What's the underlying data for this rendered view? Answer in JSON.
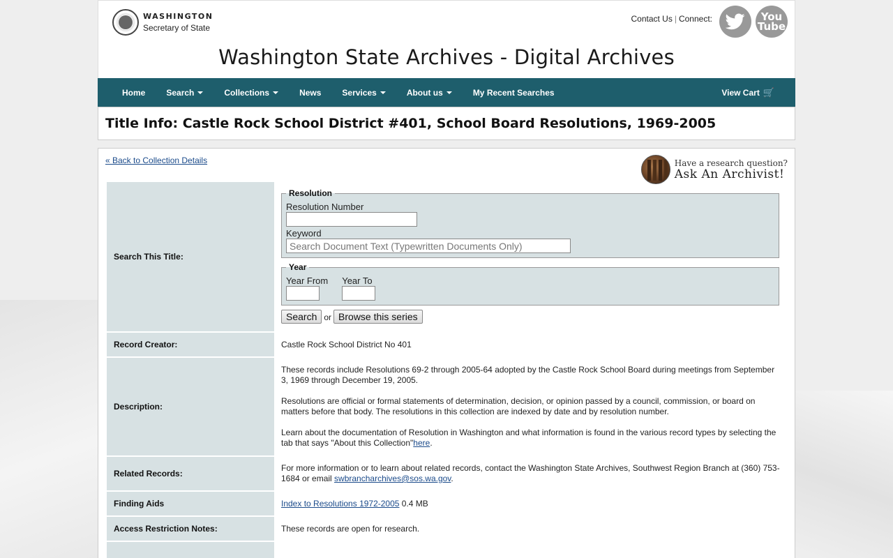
{
  "header": {
    "logo_line1": "WASHINGTON",
    "logo_line2": "Secretary of State",
    "contact_us": "Contact Us",
    "separator": "|",
    "connect": "Connect:",
    "youtube_line1": "You",
    "youtube_line2": "Tube",
    "site_title": "Washington State Archives - Digital Archives"
  },
  "nav": {
    "items": [
      {
        "label": "Home",
        "dropdown": false
      },
      {
        "label": "Search",
        "dropdown": true
      },
      {
        "label": "Collections",
        "dropdown": true
      },
      {
        "label": "News",
        "dropdown": false
      },
      {
        "label": "Services",
        "dropdown": true
      },
      {
        "label": "About us",
        "dropdown": true
      },
      {
        "label": "My Recent Searches",
        "dropdown": false
      }
    ],
    "cart": "View Cart",
    "color": "#1e5e6c"
  },
  "title": "Title Info: Castle Rock School District #401, School Board Resolutions, 1969-2005",
  "back_link": "« Back to Collection Details",
  "archivist": {
    "question": "Have a research question?",
    "ask": "Ask An Archivist!"
  },
  "search": {
    "label": "Search This Title:",
    "resolution_legend": "Resolution",
    "resolution_number_label": "Resolution Number",
    "resolution_number_value": "",
    "keyword_label": "Keyword",
    "keyword_placeholder": "Search Document Text (Typewritten Documents Only)",
    "year_legend": "Year",
    "year_from_label": "Year From",
    "year_to_label": "Year To",
    "search_button": "Search",
    "or": "or",
    "browse_button": "Browse this series"
  },
  "rows": {
    "creator_label": "Record Creator:",
    "creator_value": "Castle Rock School District No 401",
    "description_label": "Description:",
    "description_p1": "These records include Resolutions 69-2 through 2005-64 adopted by the Castle Rock School Board during meetings from September 3, 1969 through December 19, 2005.",
    "description_p2": "Resolutions are official or formal statements of determination, decision, or opinion passed by a council, commission, or board on matters before that body. The resolutions in this collection are indexed by date and by resolution number.",
    "description_p3_text": "Learn about the documentation of Resolution in Washington and what information is found in the various record types by selecting the tab that says \"About this Collection\"",
    "description_p3_link": "here",
    "description_p3_end": ".",
    "related_label": "Related Records:",
    "related_text": "For more information or to learn about related records, contact the Washington State Archives, Southwest Region Branch at (360) 753-1684 or email ",
    "related_email": "swbrancharchives@sos.wa.gov",
    "related_end": ".",
    "finding_label": "Finding Aids",
    "finding_link": "Index to Resolutions 1972-2005",
    "finding_size": " 0.4 MB",
    "access_label": "Access Restriction Notes:",
    "access_value": "These records are open for research."
  }
}
